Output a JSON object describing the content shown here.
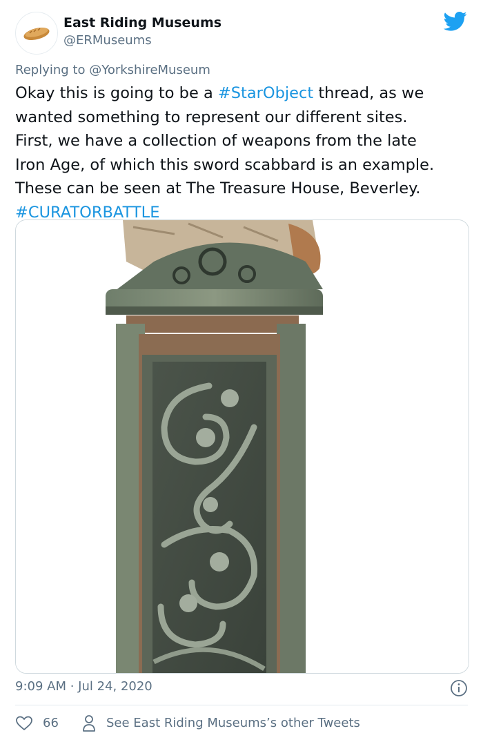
{
  "account": {
    "name": "East Riding Museums",
    "handle": "@ERMuseums",
    "avatar_icon": "bread-loaf-icon"
  },
  "reply": {
    "prefix": "Replying to",
    "mention": "@YorkshireMuseum"
  },
  "tweet": {
    "lines": [
      {
        "pre": "Okay this is going to be a ",
        "tag": "#StarObject",
        "post": " thread, as we"
      },
      {
        "pre": "wanted something to represent our different sites.",
        "tag": "",
        "post": ""
      },
      {
        "pre": "First, we have a collection of weapons from the late",
        "tag": "",
        "post": ""
      },
      {
        "pre": "Iron Age, of which this sword scabbard is an example.",
        "tag": "",
        "post": ""
      },
      {
        "pre": "These can be seen at The Treasure House, Beverley.",
        "tag": "",
        "post": ""
      },
      {
        "pre": "",
        "tag": "#CURATORBATTLE",
        "post": ""
      }
    ]
  },
  "timestamp": "9:09 AM · Jul 24, 2020",
  "footer": {
    "likes": "66",
    "other_tweets": "See East Riding Museums’s other Tweets"
  },
  "colors": {
    "link": "#1b95e0",
    "muted": "#5b7083",
    "twitter_blue": "#1da1f2"
  }
}
